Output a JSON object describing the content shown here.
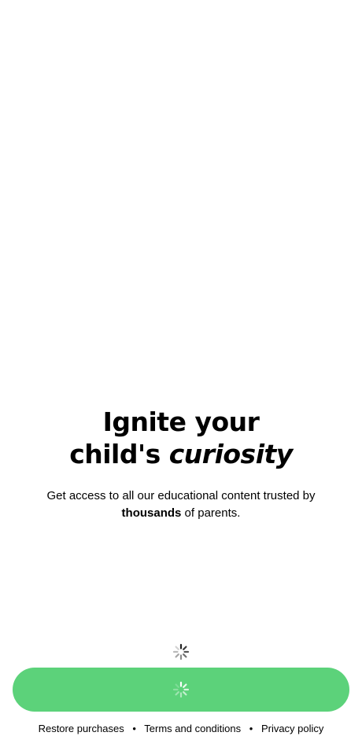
{
  "hero": {
    "headline_line1": "Ignite your",
    "headline_line2_prefix": "child's ",
    "headline_line2_italic": "curiosity",
    "subtitle_prefix": "Get access to all our educational content trusted by ",
    "subtitle_bold": "thousands",
    "subtitle_suffix": " of parents."
  },
  "status": {
    "loading_icon": "activity-spinner-icon"
  },
  "cta": {
    "color": "#5cd27a",
    "state": "loading",
    "icon": "activity-spinner-icon"
  },
  "footer": {
    "restore_label": "Restore purchases",
    "separator": "•",
    "terms_label": "Terms and conditions",
    "privacy_label": "Privacy policy"
  }
}
